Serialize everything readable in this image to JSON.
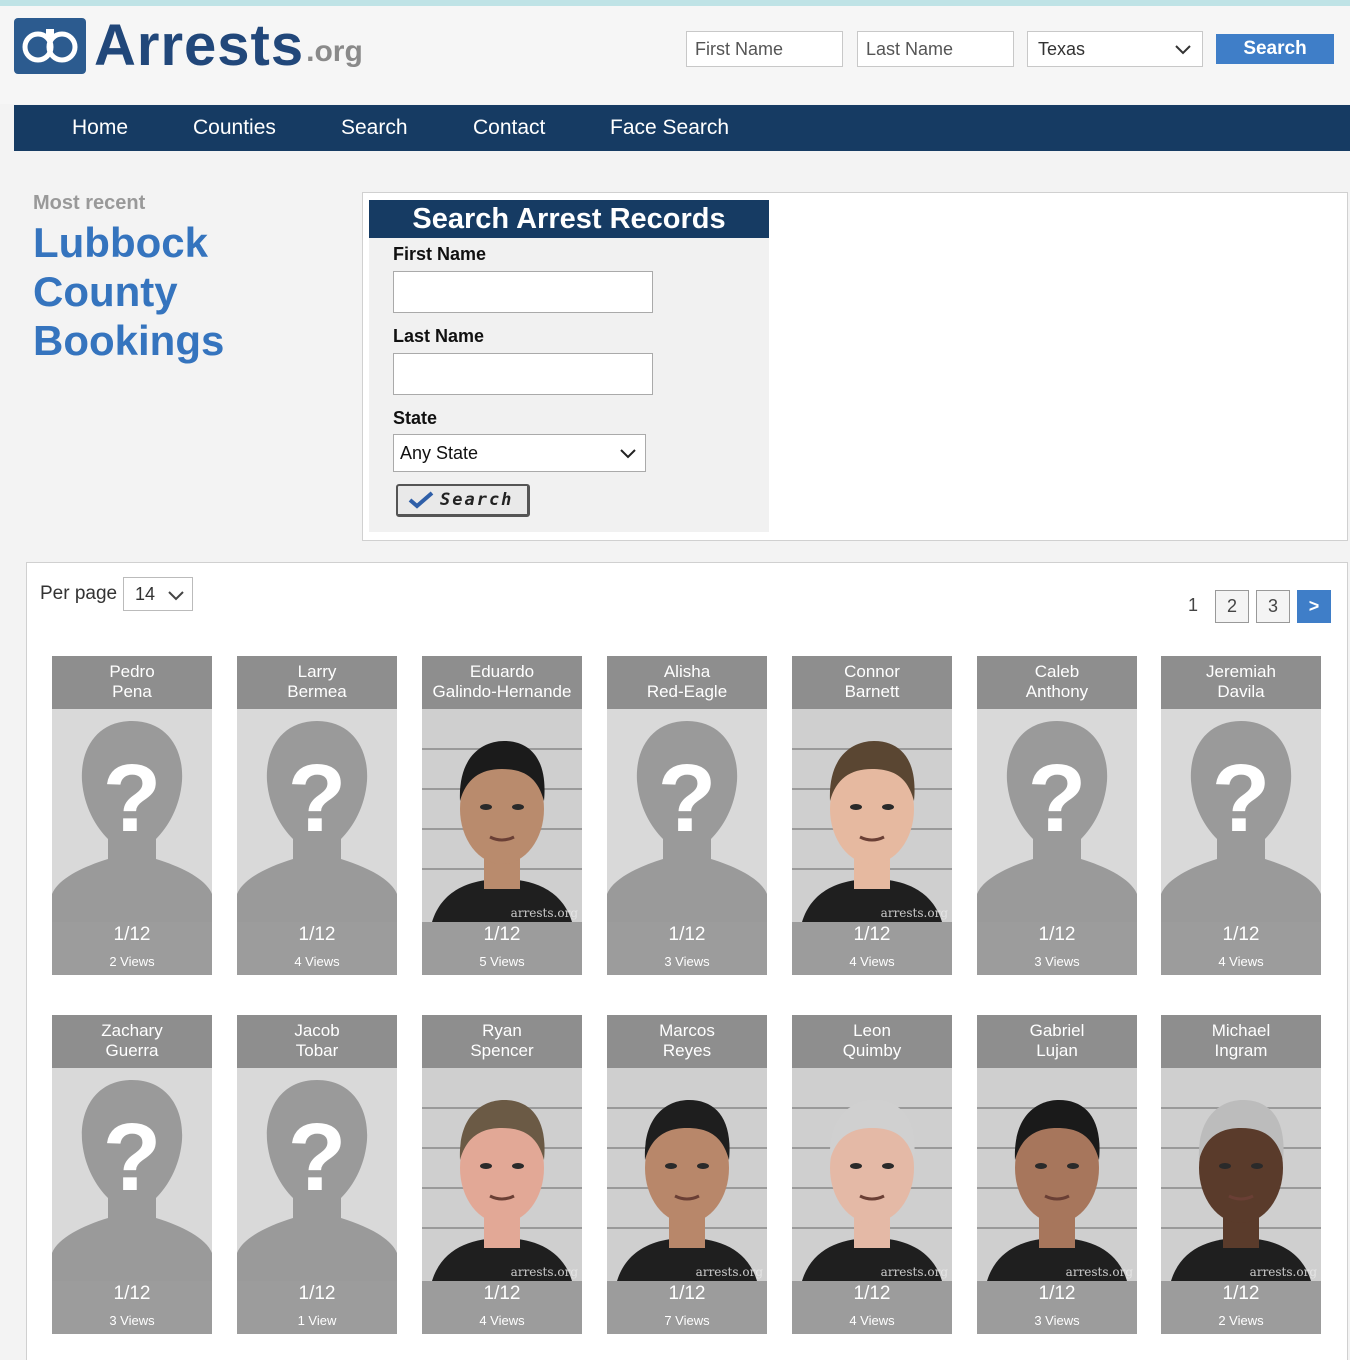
{
  "header": {
    "logo_text": "Arrests",
    "logo_suffix": ".org",
    "first_name_placeholder": "First Name",
    "last_name_placeholder": "Last Name",
    "state_value": "Texas",
    "search_label": "Search"
  },
  "nav": {
    "items": [
      {
        "label": "Home"
      },
      {
        "label": "Counties"
      },
      {
        "label": "Search"
      },
      {
        "label": "Contact"
      },
      {
        "label": "Face Search"
      }
    ]
  },
  "sidebar": {
    "recent_label": "Most recent",
    "title_lines": [
      "Lubbock",
      "County",
      "Bookings"
    ]
  },
  "search_form": {
    "title": "Search Arrest Records",
    "first_name_label": "First Name",
    "last_name_label": "Last Name",
    "state_label": "State",
    "state_value": "Any State",
    "button_label": "Search"
  },
  "results": {
    "per_page_label": "Per page",
    "per_page_value": "14",
    "pages": [
      "1",
      "2",
      "3"
    ],
    "next_label": ">",
    "watermark": "arrests.org",
    "bookings": [
      {
        "first": "Pedro",
        "last": "Pena",
        "date": "1/12",
        "views": "2 Views",
        "photo": "placeholder"
      },
      {
        "first": "Larry",
        "last": "Bermea",
        "date": "1/12",
        "views": "4 Views",
        "photo": "placeholder"
      },
      {
        "first": "Eduardo",
        "last": "Galindo-Hernande",
        "date": "1/12",
        "views": "5 Views",
        "photo": "mugshot"
      },
      {
        "first": "Alisha",
        "last": "Red-Eagle",
        "date": "1/12",
        "views": "3 Views",
        "photo": "placeholder"
      },
      {
        "first": "Connor",
        "last": "Barnett",
        "date": "1/12",
        "views": "4 Views",
        "photo": "mugshot"
      },
      {
        "first": "Caleb",
        "last": "Anthony",
        "date": "1/12",
        "views": "3 Views",
        "photo": "placeholder"
      },
      {
        "first": "Jeremiah",
        "last": "Davila",
        "date": "1/12",
        "views": "4 Views",
        "photo": "placeholder"
      },
      {
        "first": "Zachary",
        "last": "Guerra",
        "date": "1/12",
        "views": "3 Views",
        "photo": "placeholder"
      },
      {
        "first": "Jacob",
        "last": "Tobar",
        "date": "1/12",
        "views": "1 View",
        "photo": "placeholder"
      },
      {
        "first": "Ryan",
        "last": "Spencer",
        "date": "1/12",
        "views": "4 Views",
        "photo": "mugshot"
      },
      {
        "first": "Marcos",
        "last": "Reyes",
        "date": "1/12",
        "views": "7 Views",
        "photo": "mugshot"
      },
      {
        "first": "Leon",
        "last": "Quimby",
        "date": "1/12",
        "views": "4 Views",
        "photo": "mugshot"
      },
      {
        "first": "Gabriel",
        "last": "Lujan",
        "date": "1/12",
        "views": "3 Views",
        "photo": "mugshot"
      },
      {
        "first": "Michael",
        "last": "Ingram",
        "date": "1/12",
        "views": "2 Views",
        "photo": "mugshot"
      }
    ]
  },
  "colors": {
    "brand_navy": "#163b63",
    "brand_blue": "#3574be",
    "button_blue": "#3f7ec8"
  }
}
